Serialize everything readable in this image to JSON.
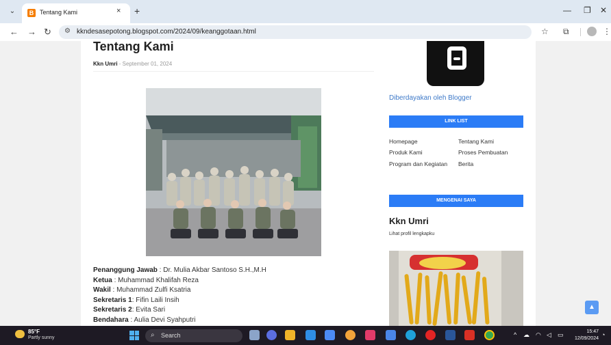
{
  "browser": {
    "tab_title": "Tentang Kami",
    "tab_close": "×",
    "new_tab": "+",
    "url": "kkndesasepotong.blogspot.com/2024/09/keanggotaan.html"
  },
  "post": {
    "title": "Tentang Kami",
    "author": "Kkn Umri",
    "separator": " - ",
    "date": "September 01, 2024",
    "details": [
      {
        "label": "Penanggung Jawab",
        "value": " : Dr. Mulia Akbar Santoso S.H.,M.H"
      },
      {
        "label": "Ketua",
        "value": " : Muhammad Khalifah Reza"
      },
      {
        "label": "Wakil",
        "value": " : Muhammad Zulfi Ksatria"
      },
      {
        "label": "Sekretaris 1",
        "value": ": Fifin Laili Insih"
      },
      {
        "label": "Sekretaris 2",
        "value": ": Evita Sari"
      },
      {
        "label": "Bendahara",
        "value": " : Aulia Devi Syahputri"
      }
    ]
  },
  "sidebar": {
    "powered_by": "Diberdayakan oleh Blogger",
    "link_list_heading": "LINK LIST",
    "links": [
      "Homepage",
      "Tentang Kami",
      "Produk Kami",
      "Proses Pembuatan",
      "Program dan Kegiatan",
      "Berita"
    ],
    "about_heading": "MENGENAI SAYA",
    "about_name": "Kkn Umri",
    "about_link": "Lihat profil lengkapku"
  },
  "taskbar": {
    "temperature": "85°F",
    "weather": "Partly sunny",
    "search_placeholder": "Search",
    "time": "15:47",
    "date": "12/09/2024"
  },
  "colors": {
    "accent": "#2b7cf6",
    "link": "#3c78c8",
    "blogger": "#f57d00"
  }
}
